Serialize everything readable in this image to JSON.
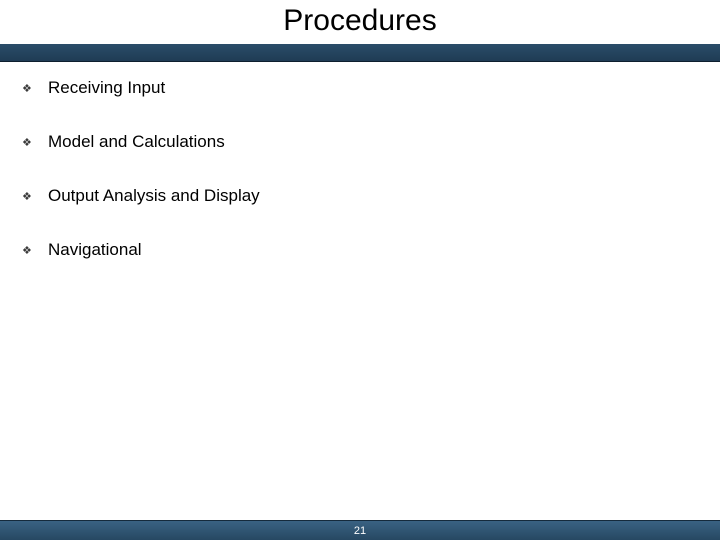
{
  "slide": {
    "title": "Procedures",
    "bullets": [
      {
        "label": "Receiving Input"
      },
      {
        "label": "Model and Calculations"
      },
      {
        "label": "Output Analysis and Display"
      },
      {
        "label": "Navigational"
      }
    ],
    "page_number": "21"
  }
}
